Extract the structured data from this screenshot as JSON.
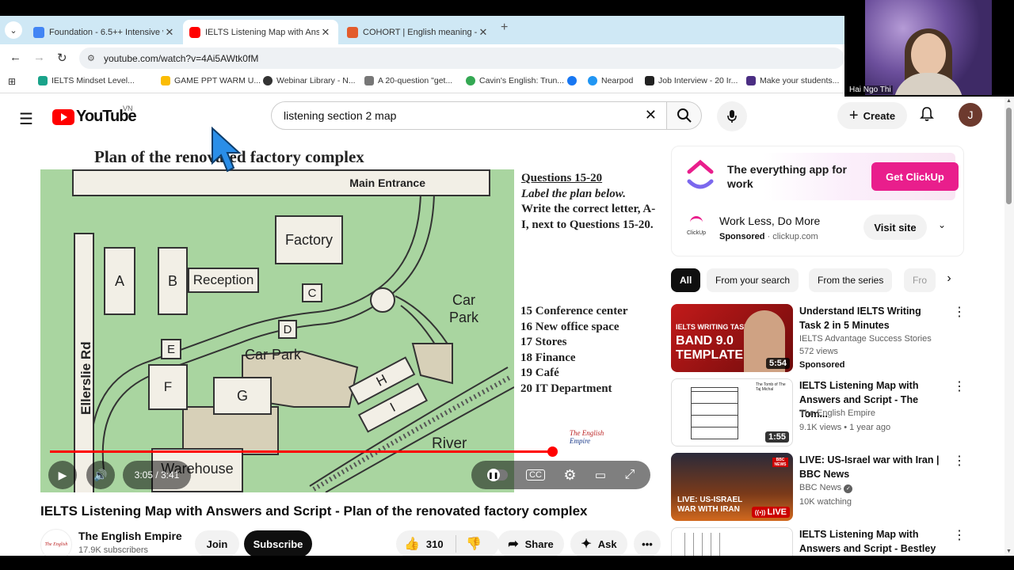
{
  "browser": {
    "tabs": [
      {
        "title": "Foundation - 6.5++ Intensive w",
        "icon_color": "#4285f4"
      },
      {
        "title": "IELTS Listening Map with Answ",
        "icon_color": "#ff0000"
      },
      {
        "title": "COHORT | English meaning - C",
        "icon_color": "#e35c2c"
      }
    ],
    "url": "youtube.com/watch?v=4Ai5AWtk0fM",
    "bookmarks": [
      {
        "label": "IELTS Mindset Level...",
        "icon_color": "#1aa38a"
      },
      {
        "label": "GAME PPT WARM U...",
        "icon_color": "#fbbc04"
      },
      {
        "label": "Webinar Library - N...",
        "icon_color": "#333333"
      },
      {
        "label": "A 20-question \"get...",
        "icon_color": "#555555"
      },
      {
        "label": "Cavin's English: Trun...",
        "icon_color": "#34a853"
      },
      {
        "label": "",
        "icon_color": "#1877f2"
      },
      {
        "label": "Nearpod",
        "icon_color": "#2196f3"
      },
      {
        "label": "Job Interview - 20 Ir...",
        "icon_color": "#222222"
      },
      {
        "label": "Make your students...",
        "icon_color": "#4b2e83"
      }
    ]
  },
  "webcam": {
    "name": "Hai Ngo Thi"
  },
  "youtube": {
    "country": "VN",
    "search_query": "listening section 2 map",
    "create_label": "Create",
    "avatar_letter": "J",
    "video": {
      "map_title": "Plan of the renovated factory complex",
      "map_labels": {
        "main_entrance": "Main Entrance",
        "factory": "Factory",
        "reception": "Reception",
        "car_park_1": "Car Park",
        "car_park_2": "Car\nPark",
        "warehouse": "Warehouse",
        "road": "Ellerslie Rd",
        "river": "River",
        "letters": [
          "A",
          "B",
          "C",
          "D",
          "E",
          "F",
          "G",
          "H",
          "I"
        ]
      },
      "questions_head": "Questions 15-20",
      "instructions_italic": "Label the plan below.",
      "instructions": "Write the correct letter, A-I, next to Questions 15-20.",
      "question_list": [
        "15 Conference center",
        "16 New office space",
        "17 Stores",
        "18 Finance",
        "19 Café",
        "20 IT Department"
      ],
      "watermark": "The English Empire",
      "time": "3:05 / 3:41",
      "progress": 0.837
    },
    "title": "IELTS Listening Map with Answers and Script - Plan of the renovated factory complex",
    "channel": {
      "name": "The English Empire",
      "subs": "17.9K subscribers",
      "avatar_text": "The English Empire"
    },
    "join_label": "Join",
    "subscribe_label": "Subscribe",
    "likes": "310",
    "share_label": "Share",
    "ask_label": "Ask",
    "ad": {
      "headline": "The everything app for work",
      "cta": "Get ClickUp",
      "icon_label": "ClickUp",
      "title": "Work Less, Do More",
      "sponsored": "Sponsored",
      "domain": "clickup.com",
      "visit_label": "Visit site"
    },
    "chips": [
      "All",
      "From your search",
      "From the series",
      "Fro"
    ],
    "recommendations": [
      {
        "title": "Understand IELTS Writing Task 2 in 5 Minutes",
        "channel": "IELTS Advantage Success Stories",
        "meta": "572 views",
        "badge": "Sponsored",
        "duration": "5:54",
        "thumb_text": "BAND 9.0 TEMPLATE",
        "thumb_top": "IELTS WRITING TASK 2"
      },
      {
        "title": "IELTS Listening Map with Answers and Script - The Tom...",
        "channel": "The English Empire",
        "meta": "9.1K views • 1 year ago",
        "duration": "1:55",
        "thumb_text": "The Tomb of The Taj Michal"
      },
      {
        "title": "LIVE: US-Israel war with Iran | BBC News",
        "channel": "BBC News",
        "meta": "10K watching",
        "duration": "LIVE",
        "thumb_text": "LIVE: US-ISRAEL WAR WITH IRAN"
      },
      {
        "title": "IELTS Listening Map with Answers and Script - Bestley ...",
        "channel": "",
        "meta": "",
        "duration": ""
      }
    ]
  }
}
